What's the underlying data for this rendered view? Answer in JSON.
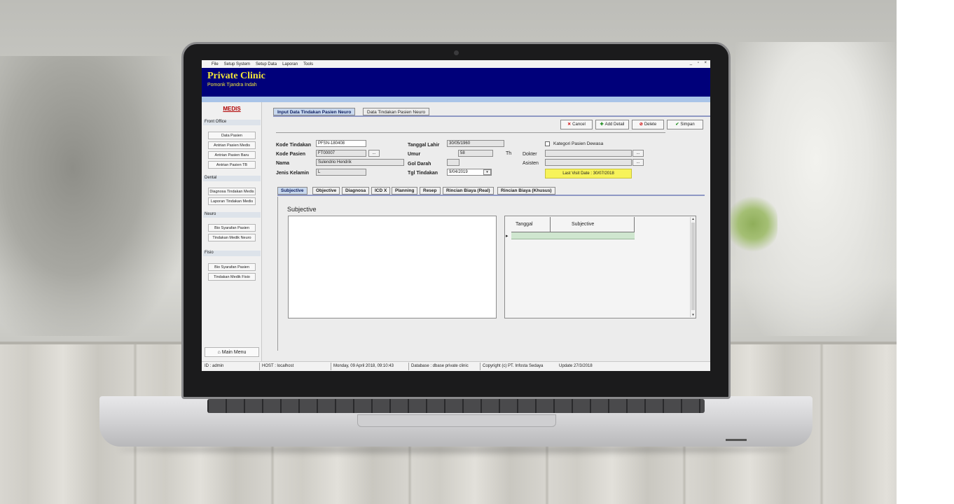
{
  "menu": {
    "items": [
      "File",
      "Setup System",
      "Setup Data",
      "Laporan",
      "Tools"
    ],
    "controls": "_ ▫ ×"
  },
  "banner": {
    "title": "Private Clinic",
    "subtitle": "Pomonk Tjandra Indah"
  },
  "sidebar": {
    "title": "MEDIS",
    "groups": [
      {
        "label": "Front Office",
        "items": [
          "Data Pasien",
          "Antrian Pasien Medis",
          "Antrian Pasien Baru",
          "Antrian Pasien TB"
        ]
      },
      {
        "label": "Dental",
        "items": [
          "Diagnosa Tindakan Medis",
          "Laporan Tindakan Medis"
        ]
      },
      {
        "label": "Neuro",
        "items": [
          "Bio Syarafan Pasien",
          "Tindakan Medik Neuro"
        ]
      },
      {
        "label": "Fisio",
        "items": [
          "Bio Syarafan Pasien",
          "Tindakan Medik Fisio"
        ]
      }
    ],
    "main_menu": "Main Menu"
  },
  "tabs": {
    "input": "Input Data Tindakan Pasien Neuro",
    "data": "Data Tindakan Pasien Neuro"
  },
  "actions": {
    "cancel": "Cancel",
    "add": "Add Detail",
    "delete": "Delete",
    "save": "Simpan"
  },
  "form": {
    "kode_tindakan_label": "Kode Tindakan",
    "kode_tindakan_value": "PFSN-180408",
    "kode_pasien_label": "Kode Pasien",
    "kode_pasien_value": "FT00007",
    "lookup": "...",
    "nama_label": "Nama",
    "nama_value": "Sulendrio Hendrik",
    "jk_label": "Jenis Kelamin",
    "jk_value": "L",
    "tgl_lahir_label": "Tanggal Lahir",
    "tgl_lahir_value": "30/05/1960",
    "umur_label": "Umur",
    "umur_value": "58",
    "umur_unit": "Th",
    "gol_darah_label": "Gol Darah",
    "tgl_tindakan_label": "Tgl Tindakan",
    "tgl_tindakan_value": "9/04/2019",
    "kategori_label": "Kategori Pasien Dewasa",
    "dokter_label": "Dokter",
    "asisten_label": "Asisten",
    "last_visit": "Last Visit Date : 30/07/2018"
  },
  "subtabs": [
    "Subjective",
    "Objective",
    "Diagnosa",
    "ICD X",
    "Planning",
    "Resep",
    "Rincian Biaya (Real)",
    "Rincian Biaya (Khusus)"
  ],
  "panel": {
    "title": "Subjective",
    "grid_headers": [
      "Tanggal",
      "Subjective"
    ]
  },
  "status": {
    "user": "ID : admin",
    "host": "HOST : localhost",
    "datetime": "Monday, 09 April 2018, 09:10:43",
    "database": "Database : dbase private clinic",
    "copyright": "Copyright (c) PT. Infosta Sedaya",
    "update": "Update 27/3/2018"
  }
}
